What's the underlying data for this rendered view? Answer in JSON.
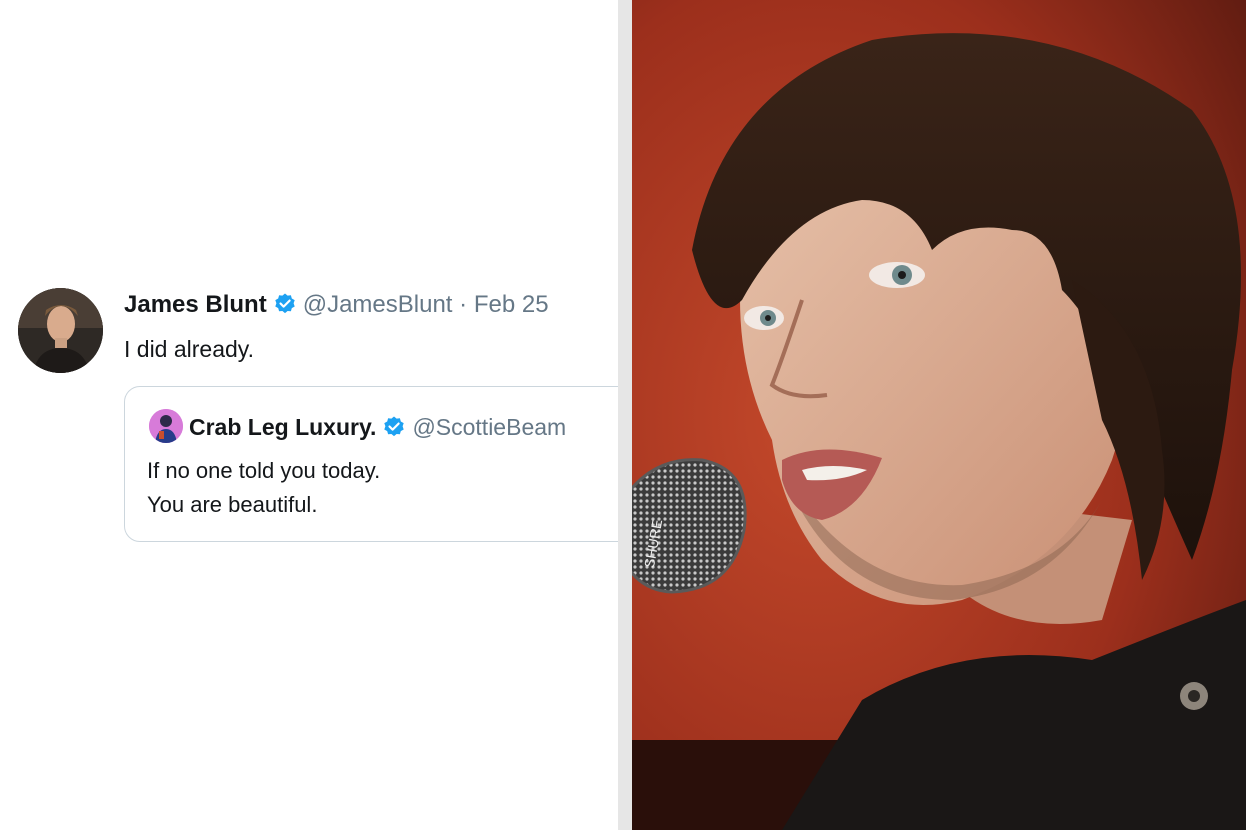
{
  "tweet": {
    "author_name": "James Blunt",
    "author_handle": "@JamesBlunt",
    "separator": "·",
    "date": "Feb 25",
    "text": "I did already."
  },
  "quoted_tweet": {
    "author_name": "Crab Leg Luxury.",
    "author_handle": "@ScottieBeam",
    "line1": "If no one told you today.",
    "line2": "You are beautiful."
  },
  "photo": {
    "subject": "man singing into microphone",
    "mic_label": "SHURE"
  },
  "colors": {
    "verified_badge": "#1da1f2",
    "muted_text": "#657786",
    "primary_text": "#14171a",
    "border": "#ccd6dd",
    "background_red": "#b0361f"
  }
}
